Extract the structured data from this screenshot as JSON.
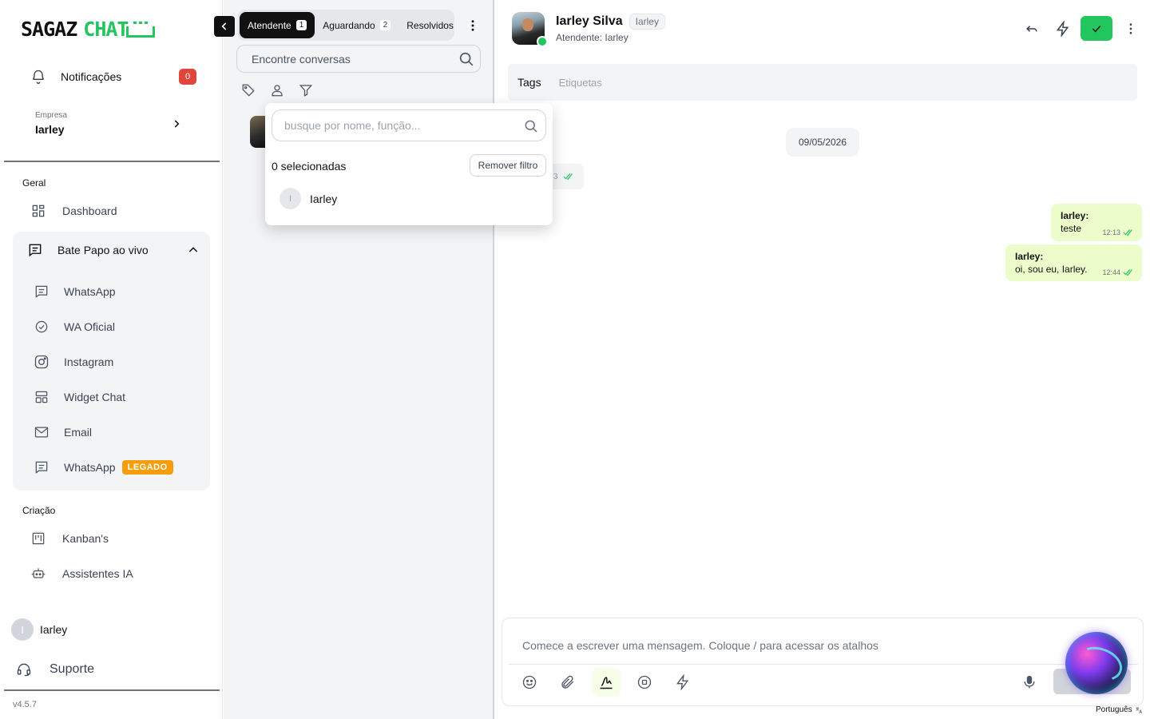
{
  "sidebar": {
    "logo": {
      "part1": "SAGAZ",
      "part2": "CHAT"
    },
    "notifications": {
      "label": "Notificações",
      "count": "0"
    },
    "company": {
      "label": "Empresa",
      "value": "Iarley"
    },
    "sections": {
      "geral": "Geral",
      "criacao": "Criação"
    },
    "items": {
      "dashboard": "Dashboard",
      "live_chat": "Bate Papo ao vivo",
      "whatsapp": "WhatsApp",
      "wa_oficial": "WA Oficial",
      "instagram": "Instagram",
      "widget_chat": "Widget Chat",
      "email": "Email",
      "whatsapp_legacy": "WhatsApp",
      "legacy_badge": "LEGADO",
      "kanbans": "Kanban's",
      "assistentes": "Assistentes IA"
    },
    "user": {
      "initial": "I",
      "name": "Iarley"
    },
    "support": "Suporte",
    "version": "v4.5.7"
  },
  "conversations": {
    "tabs": [
      {
        "label": "Atendente",
        "count": "1"
      },
      {
        "label": "Aguardando",
        "count": "2"
      },
      {
        "label": "Resolvidos"
      }
    ],
    "search_placeholder": "Encontre conversas"
  },
  "filter_dropdown": {
    "search_placeholder": "busque por nome, função...",
    "selected_text": "0 selecionadas",
    "remove_filter": "Remover filtro",
    "options": [
      {
        "initial": "I",
        "name": "Iarley"
      }
    ]
  },
  "chat": {
    "contact": {
      "name": "Iarley Silva",
      "tag": "Iarley",
      "subtitle": "Atendente: Iarley"
    },
    "tags": {
      "label": "Tags",
      "placeholder": "Etiquetas"
    },
    "date": "09/05/2026",
    "partial_message_time": "3",
    "messages": [
      {
        "author": "Iarley:",
        "text": "teste",
        "time": "12:13"
      },
      {
        "author": "Iarley:",
        "text": "oi, sou eu, Iarley.",
        "time": "12:44"
      }
    ],
    "composer_placeholder": "Comece a escrever uma mensagem. Coloque / para acessar os atalhos",
    "language": "Português"
  },
  "colors": {
    "accent": "#22c55e",
    "badge": "#e0463c",
    "legacy": "#f59e0b",
    "bubble_out": "#ecfccb"
  }
}
